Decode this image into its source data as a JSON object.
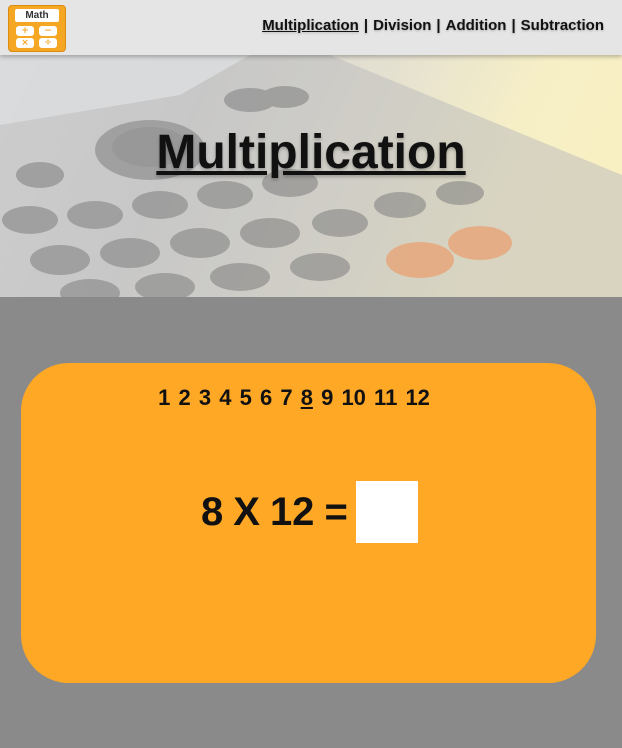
{
  "logo": {
    "title": "Math",
    "keys": [
      "+",
      "−",
      "×",
      "÷"
    ],
    "color": "#f5a623"
  },
  "nav": {
    "items": [
      {
        "label": "Multiplication",
        "active": true
      },
      {
        "label": "Division",
        "active": false
      },
      {
        "label": "Addition",
        "active": false
      },
      {
        "label": "Subtraction",
        "active": false
      }
    ],
    "separator": "|"
  },
  "hero": {
    "title": "Multiplication",
    "background": "calculator-photo"
  },
  "selector": {
    "numbers": [
      "1",
      "2",
      "3",
      "4",
      "5",
      "6",
      "7",
      "8",
      "9",
      "10",
      "11",
      "12"
    ],
    "selected": "8"
  },
  "equation": {
    "left": "8",
    "operator": "X",
    "right": "12",
    "equals": "=",
    "answer_value": ""
  },
  "colors": {
    "card": "#fea826",
    "page_background": "#8a8a8a",
    "topbar": "#e5e5e5"
  }
}
